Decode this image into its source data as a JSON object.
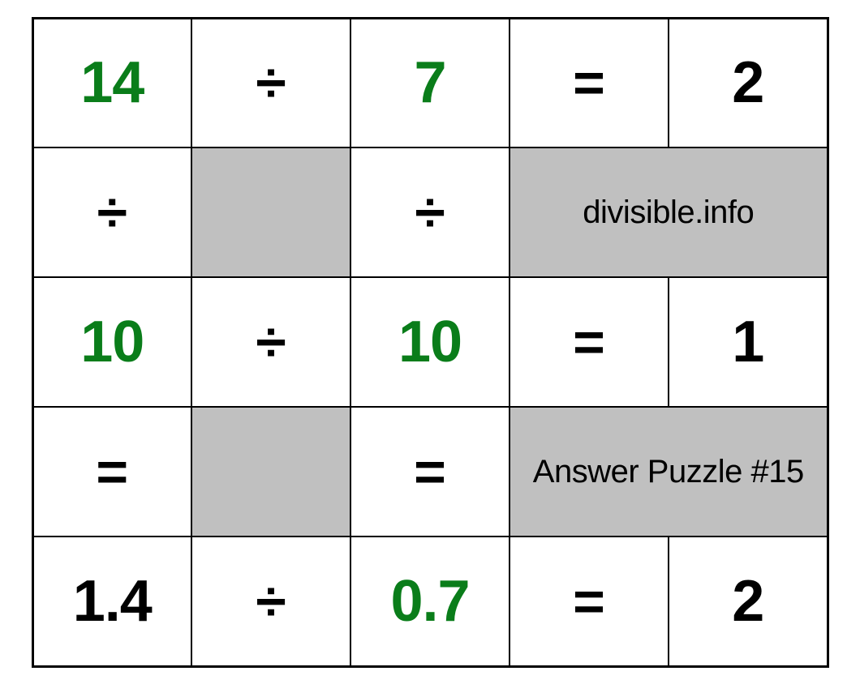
{
  "cells": {
    "r0c0": "14",
    "r0c1": "÷",
    "r0c2": "7",
    "r0c3": "=",
    "r0c4": "2",
    "r1c0": "÷",
    "r1c2": "÷",
    "r1label": "divisible.info",
    "r2c0": "10",
    "r2c1": "÷",
    "r2c2": "10",
    "r2c3": "=",
    "r2c4": "1",
    "r3c0": "=",
    "r3c2": "=",
    "r3label": "Answer Puzzle #15",
    "r4c0": "1.4",
    "r4c1": "÷",
    "r4c2": "0.7",
    "r4c3": "=",
    "r4c4": "2"
  }
}
